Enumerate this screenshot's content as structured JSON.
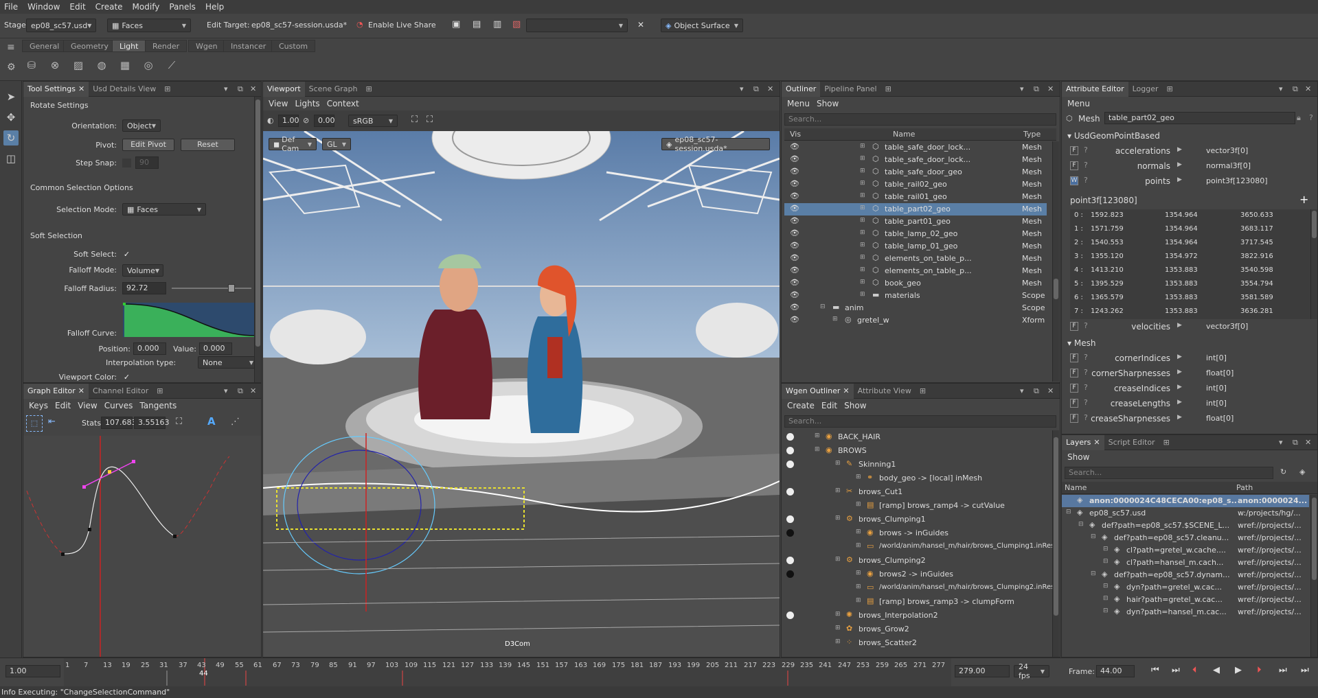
{
  "menubar": [
    "File",
    "Window",
    "Edit",
    "Create",
    "Modify",
    "Panels",
    "Help"
  ],
  "toolbar": {
    "stage_label": "Stage:",
    "stage_value": "ep08_sc57.usd",
    "mode_value": "Faces",
    "edit_target_label": "Edit Target:",
    "edit_target_value": "ep08_sc57-session.usda*",
    "live_share": "Enable Live Share",
    "object_surface": "Object Surface"
  },
  "shelf_tabs": [
    "General",
    "Geometry",
    "Light",
    "Render",
    "Wgen",
    "Instancer",
    "Custom"
  ],
  "tool_settings": {
    "tabs": [
      "Tool Settings",
      "Usd Details View"
    ],
    "title": "Rotate Settings",
    "orientation_label": "Orientation:",
    "orientation_value": "Object",
    "pivot_label": "Pivot:",
    "edit_pivot": "Edit Pivot",
    "reset": "Reset",
    "step_snap_label": "Step Snap:",
    "step_snap_value": "90",
    "common_title": "Common Selection Options",
    "selection_mode_label": "Selection Mode:",
    "selection_mode_value": "Faces",
    "soft_title": "Soft Selection",
    "soft_select_label": "Soft Select:",
    "falloff_mode_label": "Falloff Mode:",
    "falloff_mode_value": "Volume",
    "falloff_radius_label": "Falloff Radius:",
    "falloff_radius_value": "92.72",
    "falloff_curve_label": "Falloff Curve:",
    "position_label": "Position:",
    "position_value": "0.000",
    "value_label": "Value:",
    "value_value": "0.000",
    "interp_label": "Interpolation type:",
    "interp_value": "None",
    "viewport_color_label": "Viewport Color:",
    "check": "✓"
  },
  "graph_editor": {
    "tabs": [
      "Graph Editor",
      "Channel Editor"
    ],
    "menu": [
      "Keys",
      "Edit",
      "View",
      "Curves",
      "Tangents"
    ],
    "stats_label": "Stats",
    "stats_a": "107.683",
    "stats_b": "3.55163"
  },
  "viewport": {
    "tabs": [
      "Viewport",
      "Scene Graph"
    ],
    "menu": [
      "View",
      "Lights",
      "Context"
    ],
    "exposure": "1.00",
    "gamma": "0.00",
    "colorspace": "sRGB",
    "camera": "Def Cam",
    "renderer": "GL",
    "session": "ep08_sc57-session.usda*",
    "watermark": "D3Com"
  },
  "outliner": {
    "tabs": [
      "Outliner",
      "Pipeline Panel"
    ],
    "menu": [
      "Menu",
      "Show"
    ],
    "search": "Search...",
    "columns": [
      "Vis",
      "Name",
      "Type"
    ],
    "rows": [
      {
        "name": "table_safe_door_lock...",
        "type": "Mesh",
        "sel": false
      },
      {
        "name": "table_safe_door_lock...",
        "type": "Mesh",
        "sel": false
      },
      {
        "name": "table_safe_door_geo",
        "type": "Mesh",
        "sel": false
      },
      {
        "name": "table_rail02_geo",
        "type": "Mesh",
        "sel": false
      },
      {
        "name": "table_rail01_geo",
        "type": "Mesh",
        "sel": false
      },
      {
        "name": "table_part02_geo",
        "type": "Mesh",
        "sel": true
      },
      {
        "name": "table_part01_geo",
        "type": "Mesh",
        "sel": false
      },
      {
        "name": "table_lamp_02_geo",
        "type": "Mesh",
        "sel": false
      },
      {
        "name": "table_lamp_01_geo",
        "type": "Mesh",
        "sel": false
      },
      {
        "name": "elements_on_table_p...",
        "type": "Mesh",
        "sel": false
      },
      {
        "name": "elements_on_table_p...",
        "type": "Mesh",
        "sel": false
      },
      {
        "name": "book_geo",
        "type": "Mesh",
        "sel": false
      },
      {
        "name": "materials",
        "type": "Scope",
        "sel": false
      },
      {
        "name": "anim",
        "type": "Scope",
        "sel": false
      },
      {
        "name": "gretel_w",
        "type": "Xform",
        "sel": false
      }
    ]
  },
  "wgen": {
    "tabs": [
      "Wgen Outliner",
      "Attribute View"
    ],
    "menu": [
      "Create",
      "Edit",
      "Show"
    ],
    "search": "Search...",
    "rows": [
      "BACK_HAIR",
      "BROWS",
      "Skinning1",
      "body_geo -> [local] inMesh",
      "brows_Cut1",
      "[ramp] brows_ramp4 -> cutValue",
      "brows_Clumping1",
      "brows -> inGuides",
      "/world/anim/hansel_m/hair/brows_Clumping1.inRes",
      "brows_Clumping2",
      "brows2 -> inGuides",
      "/world/anim/hansel_m/hair/brows_Clumping2.inRes",
      "[ramp] brows_ramp3 -> clumpForm",
      "brows_Interpolation2",
      "brows_Grow2",
      "brows_Scatter2"
    ]
  },
  "attr_editor": {
    "tabs": [
      "Attribute Editor",
      "Logger"
    ],
    "menu": "Menu",
    "prim_type": "Mesh",
    "prim_name": "table_part02_geo",
    "section1": "UsdGeomPointBased",
    "attrs1": [
      {
        "name": "accelerations",
        "type": "vector3f[0]",
        "badge": "F"
      },
      {
        "name": "normals",
        "type": "normal3f[0]",
        "badge": "F"
      },
      {
        "name": "points",
        "type": "point3f[123080]",
        "badge": "W"
      }
    ],
    "array_title": "point3f[123080]",
    "points": [
      [
        "0 :",
        "1592.823",
        "1354.964",
        "3650.633"
      ],
      [
        "1 :",
        "1571.759",
        "1354.964",
        "3683.117"
      ],
      [
        "2 :",
        "1540.553",
        "1354.964",
        "3717.545"
      ],
      [
        "3 :",
        "1355.120",
        "1354.972",
        "3822.916"
      ],
      [
        "4 :",
        "1413.210",
        "1353.883",
        "3540.598"
      ],
      [
        "5 :",
        "1395.529",
        "1353.883",
        "3554.794"
      ],
      [
        "6 :",
        "1365.579",
        "1353.883",
        "3581.589"
      ],
      [
        "7 :",
        "1243.262",
        "1353.883",
        "3636.281"
      ]
    ],
    "velocities": {
      "name": "velocities",
      "type": "vector3f[0]"
    },
    "section2": "Mesh",
    "attrs2": [
      {
        "name": "cornerIndices",
        "type": "int[0]"
      },
      {
        "name": "cornerSharpnesses",
        "type": "float[0]"
      },
      {
        "name": "creaseIndices",
        "type": "int[0]"
      },
      {
        "name": "creaseLengths",
        "type": "int[0]"
      },
      {
        "name": "creaseSharpnesses",
        "type": "float[0]"
      }
    ]
  },
  "layers": {
    "tabs": [
      "Layers",
      "Script Editor"
    ],
    "menu": "Show",
    "search": "Search...",
    "columns": [
      "Name",
      "Path"
    ],
    "rows": [
      {
        "name": "anon:0000024C48CECA00:ep08_s...",
        "path": "anon:0000024...",
        "indent": 0,
        "sel": true
      },
      {
        "name": "ep08_sc57.usd",
        "path": "w:/projects/hg/...",
        "indent": 0,
        "sel": false
      },
      {
        "name": "def?path=ep08_sc57.$SCENE_L...",
        "path": "wref://projects/...",
        "indent": 1,
        "sel": false
      },
      {
        "name": "def?path=ep08_sc57.cleanu...",
        "path": "wref://projects/...",
        "indent": 2,
        "sel": false
      },
      {
        "name": "cl?path=gretel_w.cache....",
        "path": "wref://projects/...",
        "indent": 3,
        "sel": false
      },
      {
        "name": "cl?path=hansel_m.cach...",
        "path": "wref://projects/...",
        "indent": 3,
        "sel": false
      },
      {
        "name": "def?path=ep08_sc57.dynam...",
        "path": "wref://projects/...",
        "indent": 2,
        "sel": false
      },
      {
        "name": "dyn?path=gretel_w.cac...",
        "path": "wref://projects/...",
        "indent": 3,
        "sel": false
      },
      {
        "name": "hair?path=gretel_w.cac...",
        "path": "wref://projects/...",
        "indent": 3,
        "sel": false
      },
      {
        "name": "dyn?path=hansel_m.cac...",
        "path": "wref://projects/...",
        "indent": 3,
        "sel": false
      }
    ]
  },
  "timeline": {
    "start": "1.00",
    "ticks": [
      "1",
      "7",
      "13",
      "19",
      "25",
      "31",
      "37",
      "43",
      "49",
      "55",
      "61",
      "67",
      "73",
      "79",
      "85",
      "91",
      "97",
      "103",
      "109",
      "115",
      "121",
      "127",
      "133",
      "139",
      "145",
      "151",
      "157",
      "163",
      "169",
      "175",
      "181",
      "187",
      "193",
      "199",
      "205",
      "211",
      "217",
      "223",
      "229",
      "235",
      "241",
      "247",
      "253",
      "259",
      "265",
      "271",
      "277"
    ],
    "current_marker": "44",
    "end": "279.00",
    "fps": "24 fps",
    "frame_label": "Frame:",
    "frame_value": "44.00"
  },
  "status": "Info Executing: \"ChangeSelectionCommand\""
}
